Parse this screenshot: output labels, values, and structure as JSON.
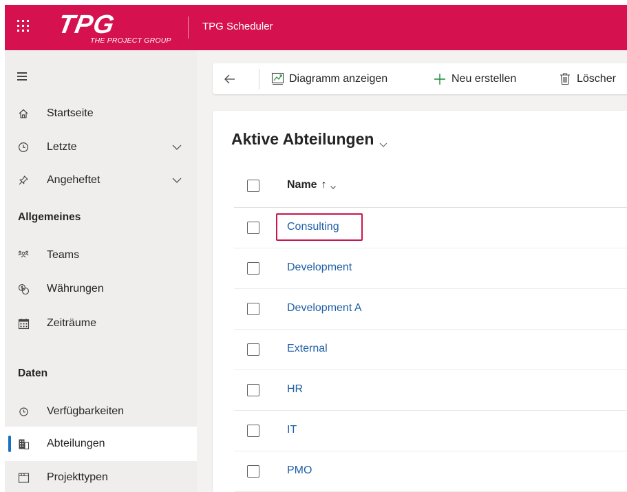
{
  "header": {
    "logo_text": "TPG",
    "logo_subtitle": "THE PROJECT GROUP",
    "app_title": "TPG Scheduler",
    "color": "#d6114f"
  },
  "sidebar": {
    "nav": [
      {
        "label": "Startseite",
        "icon": "home-icon"
      },
      {
        "label": "Letzte",
        "icon": "clock-icon",
        "expandable": true
      },
      {
        "label": "Angeheftet",
        "icon": "pin-icon",
        "expandable": true
      }
    ],
    "sections": [
      {
        "title": "Allgemeines",
        "items": [
          {
            "label": "Teams",
            "icon": "people-icon"
          },
          {
            "label": "Währungen",
            "icon": "currency-icon"
          },
          {
            "label": "Zeiträume",
            "icon": "calendar-icon"
          }
        ]
      },
      {
        "title": "Daten",
        "items": [
          {
            "label": "Verfügbarkeiten",
            "icon": "clock-icon"
          },
          {
            "label": "Abteilungen",
            "icon": "building-icon",
            "active": true
          },
          {
            "label": "Projekttypen",
            "icon": "folder-icon"
          }
        ]
      }
    ],
    "active_color": "#1a6fc2"
  },
  "commandbar": {
    "back": "back-arrow-icon",
    "buttons": [
      {
        "label": "Diagramm anzeigen",
        "icon": "chart-icon"
      },
      {
        "label": "Neu erstellen",
        "icon": "plus-icon"
      },
      {
        "label": "Löscher",
        "icon": "trash-icon"
      }
    ]
  },
  "view": {
    "title": "Aktive Abteilungen",
    "columns": [
      {
        "label": "Name",
        "sort": "↑"
      }
    ],
    "rows": [
      "Consulting",
      "Development",
      "Development A",
      "External",
      "HR",
      "IT",
      "PMO"
    ],
    "highlighted_row": "Consulting",
    "link_color": "#1f5fa6",
    "highlight_color": "#c7164d"
  }
}
